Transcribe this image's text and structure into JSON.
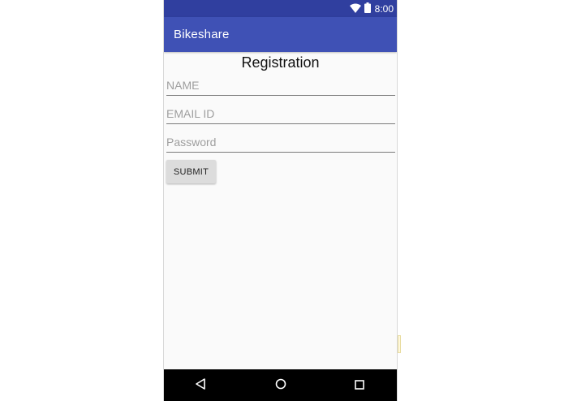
{
  "status_bar": {
    "time": "8:00",
    "icons": [
      "wifi-icon",
      "battery-icon"
    ]
  },
  "app_bar": {
    "title": "Bikeshare"
  },
  "form": {
    "title": "Registration",
    "name_placeholder": "NAME",
    "email_placeholder": "EMAIL ID",
    "password_placeholder": "Password",
    "submit_label": "SUBMIT"
  },
  "nav_bar": {
    "icons": [
      "back-icon",
      "home-icon",
      "recents-icon"
    ]
  },
  "colors": {
    "status_bar": "#303f9f",
    "app_bar": "#3f51b5",
    "background": "#fafafa",
    "button": "#dcdcdc",
    "nav_bar": "#000000"
  }
}
